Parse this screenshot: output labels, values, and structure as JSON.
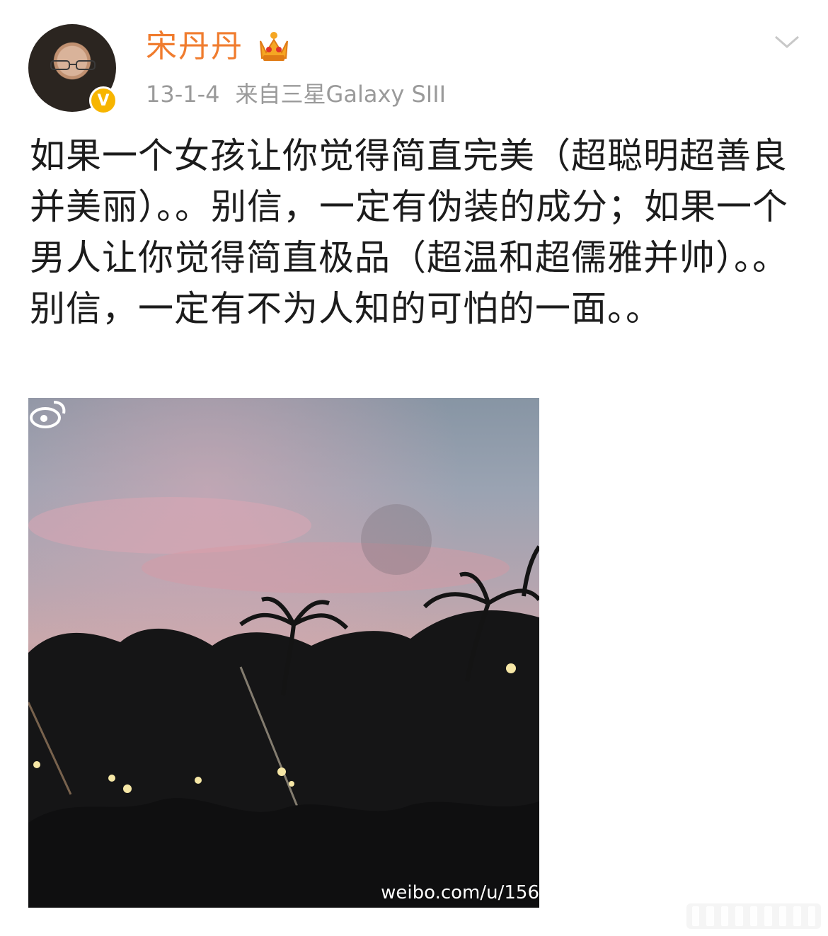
{
  "post": {
    "author": "宋丹丹",
    "date": "13-1-4",
    "source": "来自三星Galaxy SIII",
    "text": "如果一个女孩让你觉得简直完美（超聪明超善良并美丽）。。别信，一定有伪装的成分；如果一个男人让你觉得简直极品（超温和超儒雅并帅）。。别信，一定有不为人知的可怕的一面。。",
    "image": {
      "watermark": "weibo.com/u/156"
    }
  },
  "icons": {
    "verified_mark": "V",
    "verified": "verified-badge-icon",
    "crown": "vip-crown-icon",
    "expand": "chevron-down-icon",
    "weibo": "weibo-logo-icon"
  },
  "colors": {
    "username": "#f07c2e",
    "meta": "#9a9a9a",
    "verified": "#f7b500"
  }
}
